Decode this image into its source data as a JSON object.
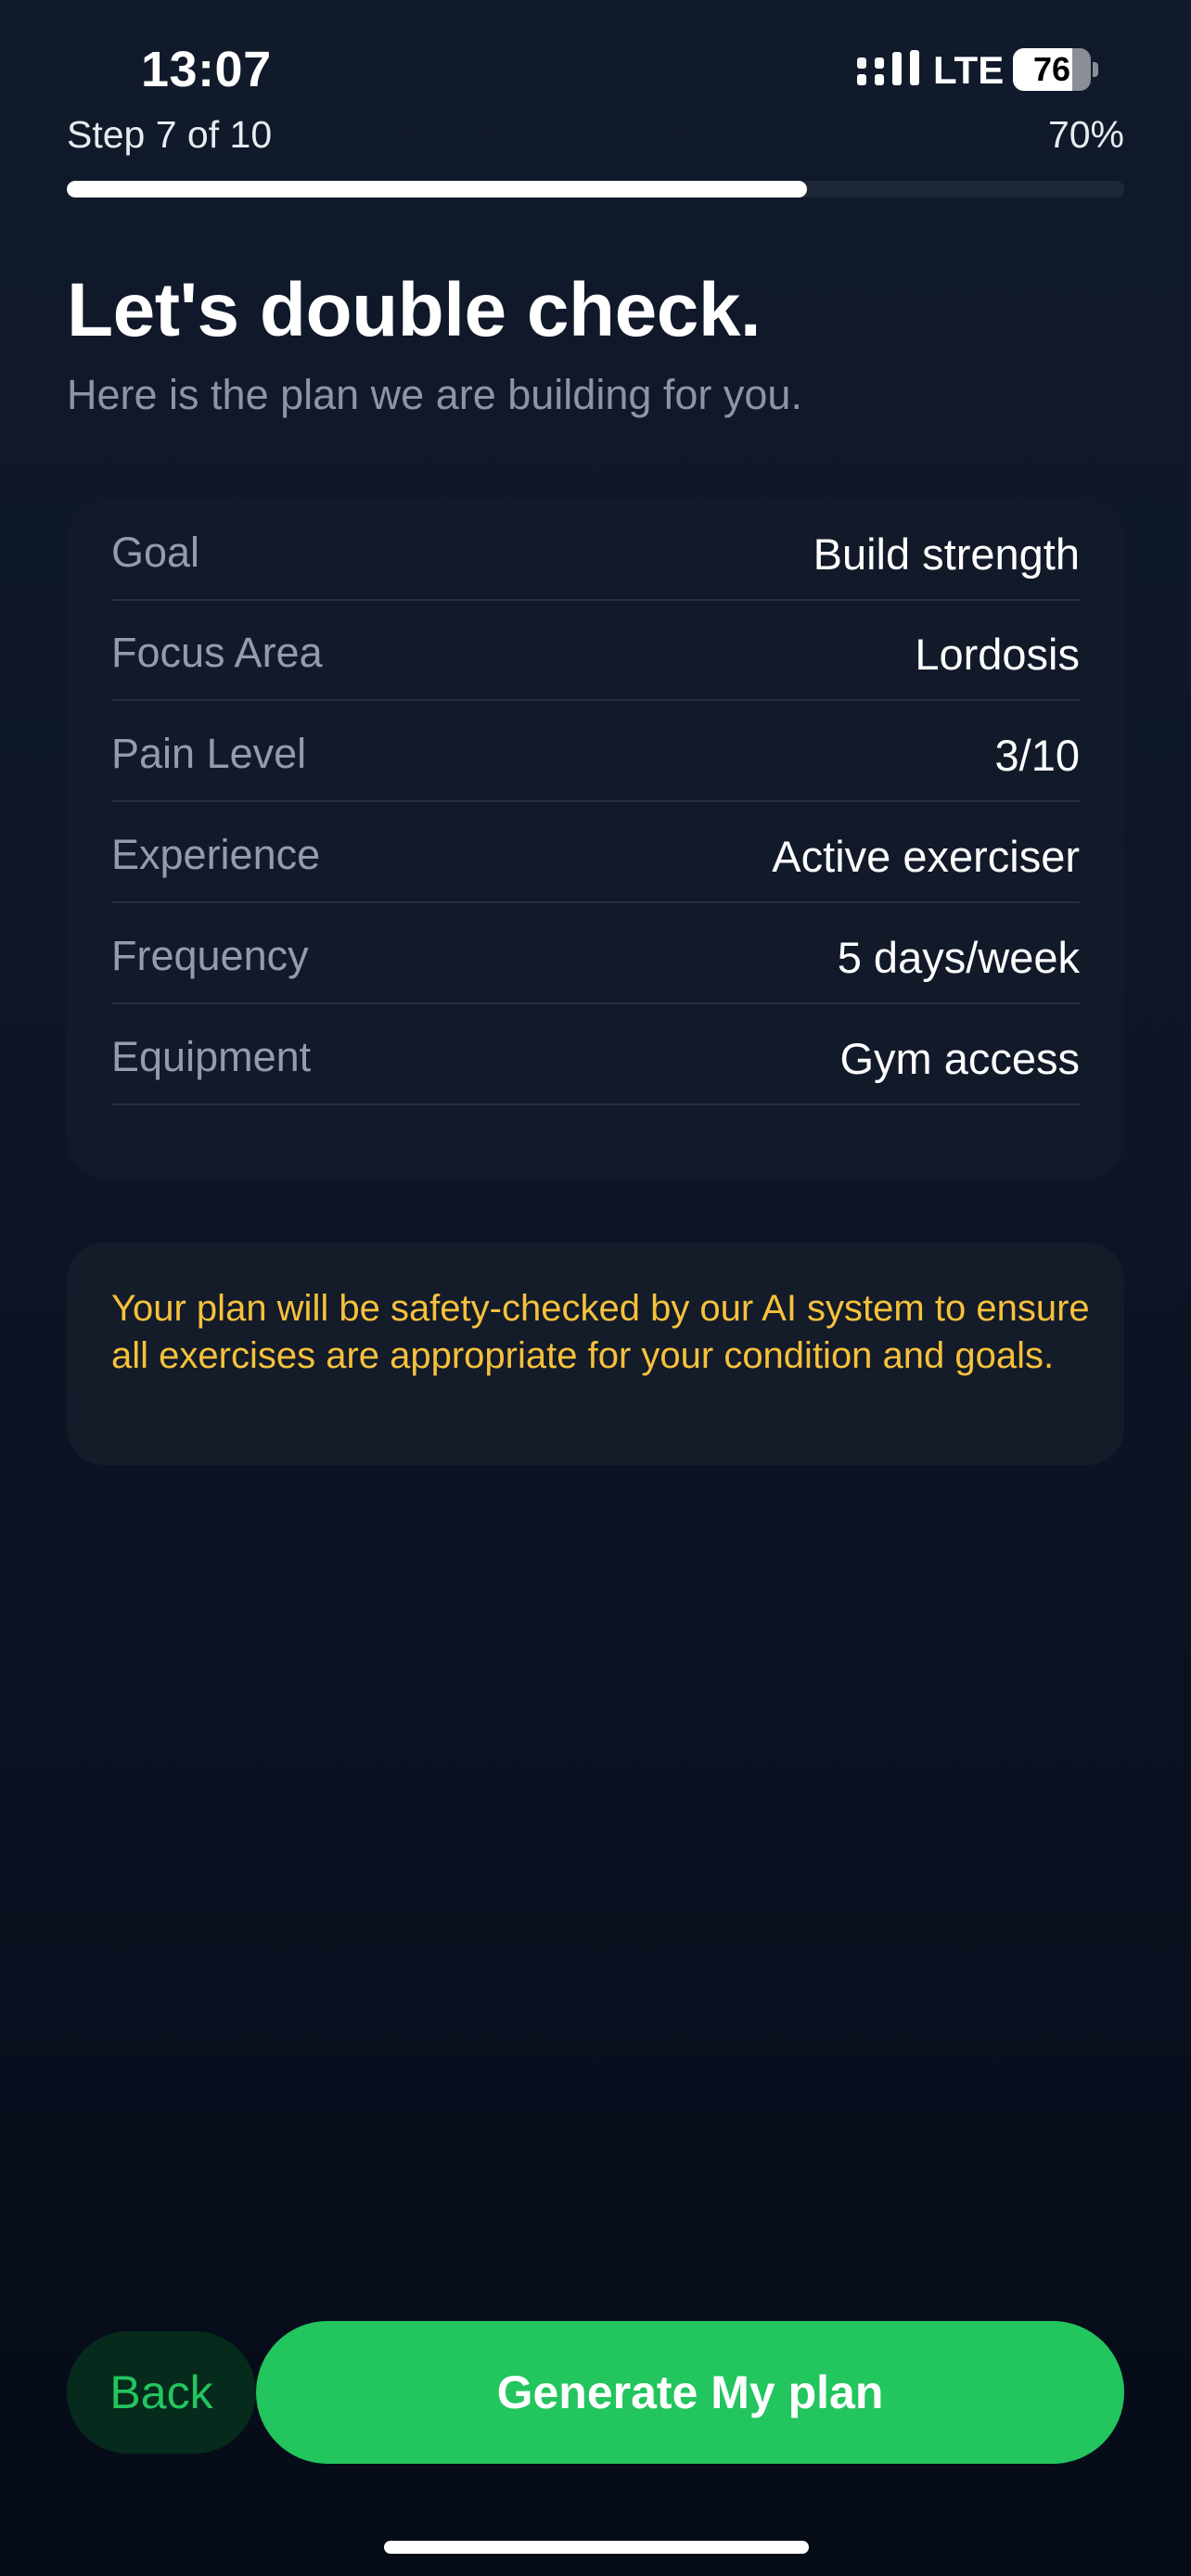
{
  "status_bar": {
    "time": "13:07",
    "network": "LTE",
    "battery": 76,
    "battery_fraction": 0.76
  },
  "progress": {
    "step_label": "Step 7 of 10",
    "percent_label": "70%",
    "fraction": 0.7
  },
  "header": {
    "title": "Let's double check.",
    "subtitle": "Here is the plan we are building for you."
  },
  "summary": {
    "rows": [
      {
        "label": "Goal",
        "value": "Build strength"
      },
      {
        "label": "Focus Area",
        "value": "Lordosis"
      },
      {
        "label": "Pain Level",
        "value": "3/10"
      },
      {
        "label": "Experience",
        "value": "Active exerciser"
      },
      {
        "label": "Frequency",
        "value": "5 days/week"
      },
      {
        "label": "Equipment",
        "value": "Gym access"
      }
    ]
  },
  "notice": {
    "text": "Your plan will be safety-checked by our AI system to ensure all exercises are appropriate for your condition and goals."
  },
  "actions": {
    "back_label": "Back",
    "generate_label": "Generate My plan"
  },
  "colors": {
    "accent_green": "#22c55e",
    "back_button_bg": "#062a1c",
    "notice_text": "#f6c13b",
    "background": "#0d1526",
    "card": "#121a2a"
  },
  "icons": {
    "signal": "signal-bars-icon",
    "battery": "battery-icon"
  }
}
